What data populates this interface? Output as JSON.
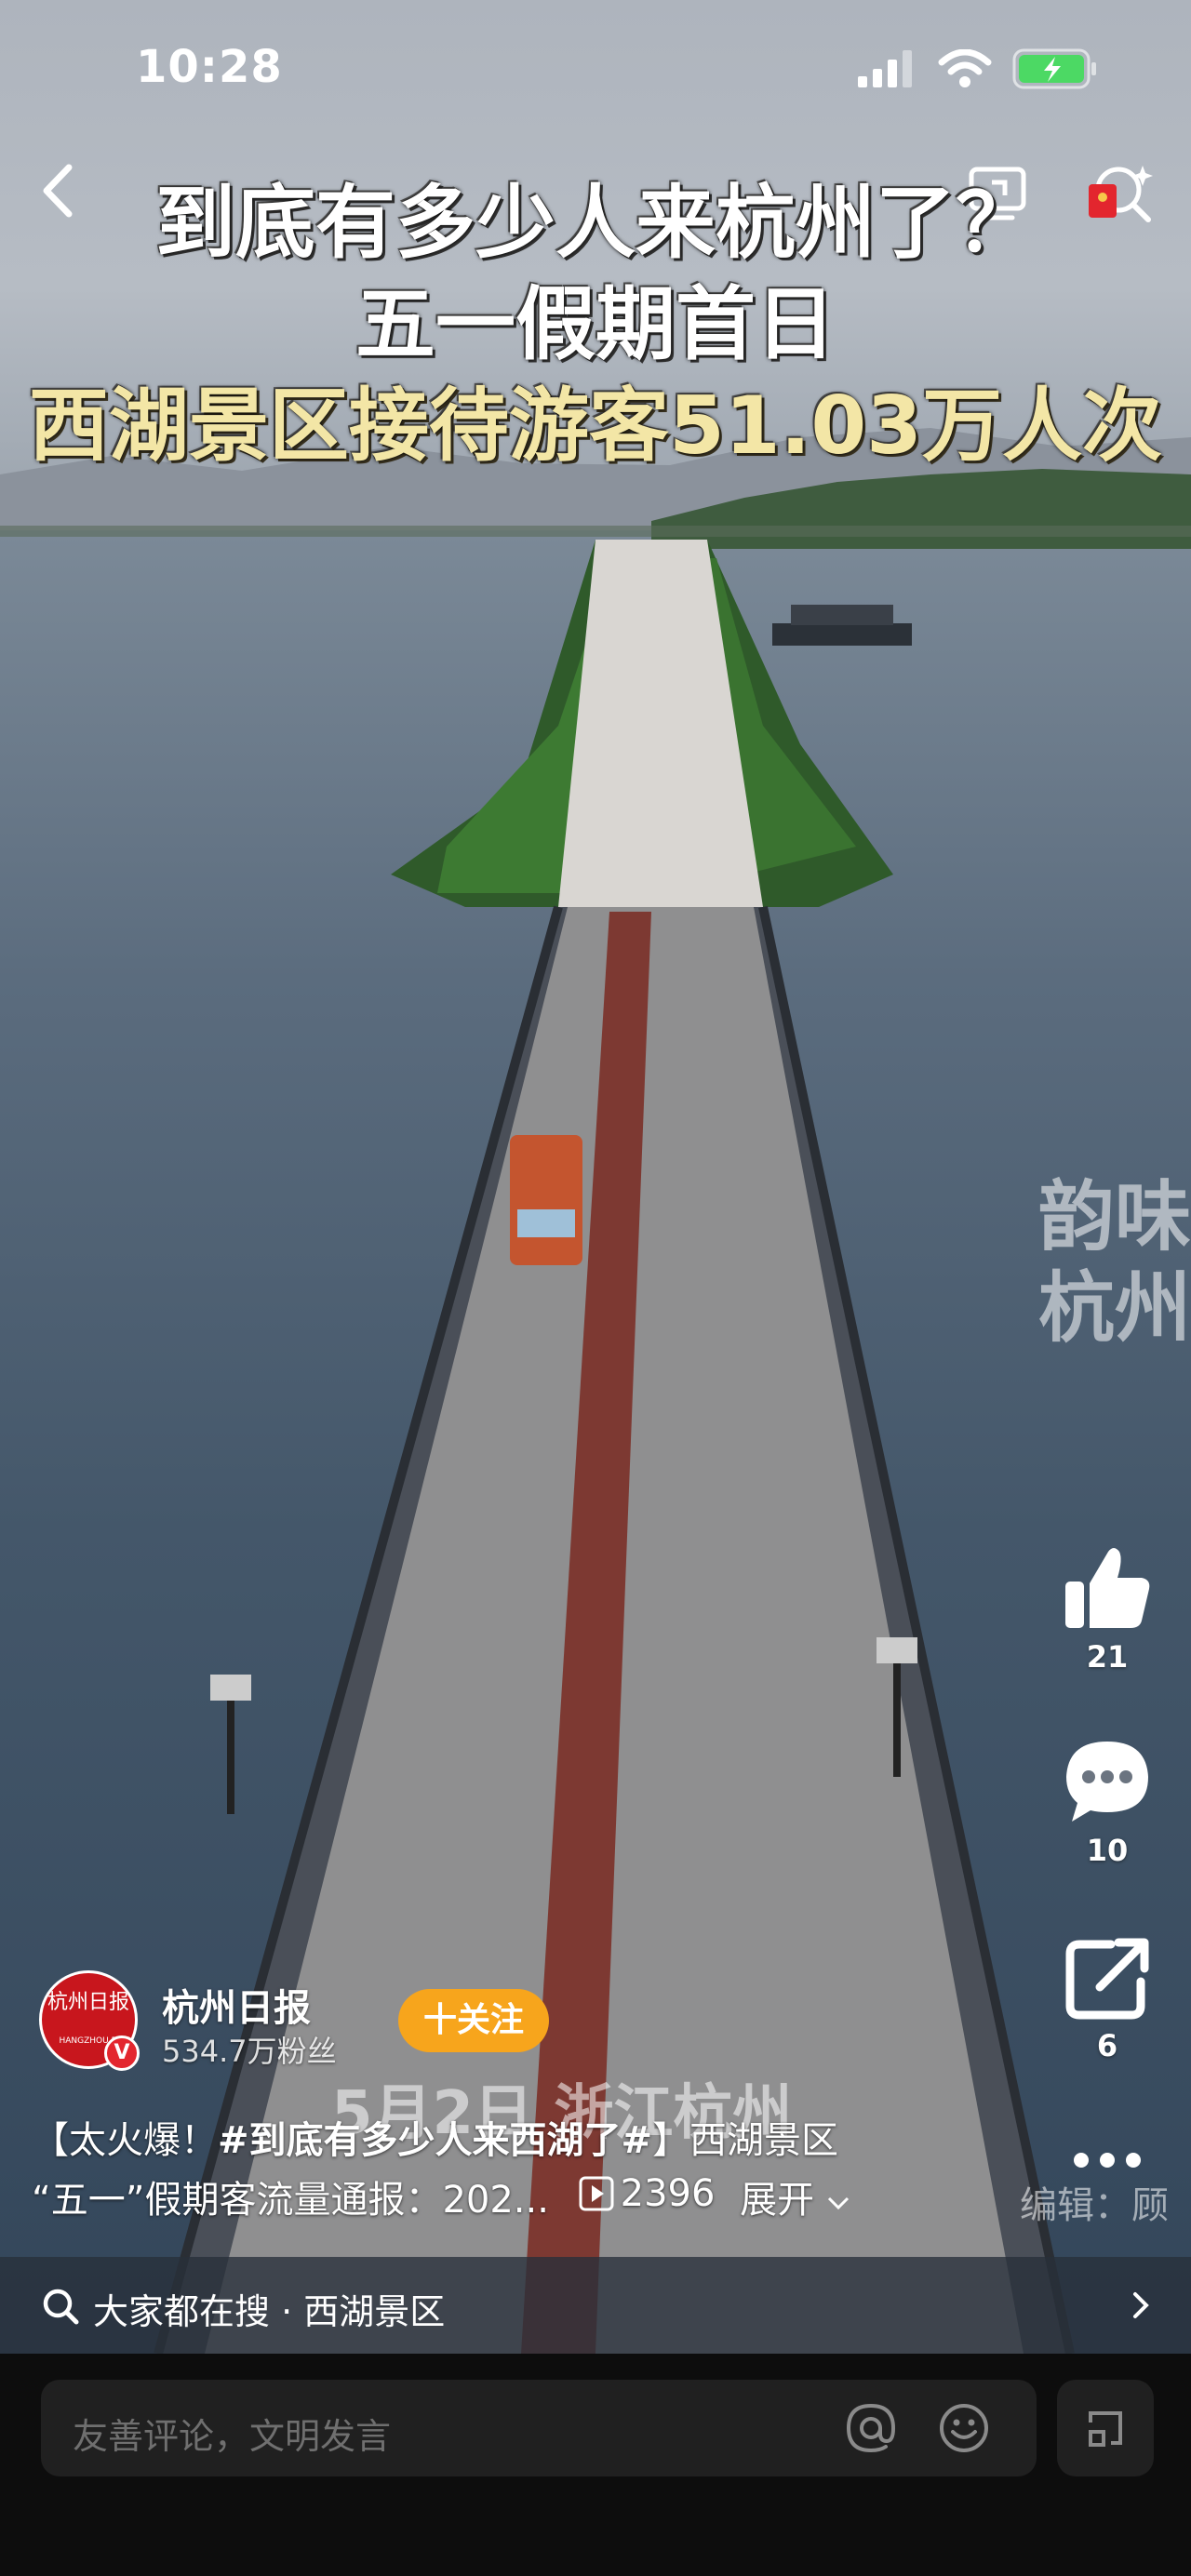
{
  "status_bar": {
    "time": "10:28",
    "battery_color": "#4cd964"
  },
  "headline": {
    "line1": "到底有多少人来杭州了？",
    "line2": "五一假期首日",
    "line3": "西湖景区接待游客51.03万人次"
  },
  "watermark": {
    "line1": "韵味",
    "line2": "杭州"
  },
  "video_caption": "5月2日 浙江杭州",
  "editor_credit": "编辑：顾",
  "actions": {
    "like_count": "21",
    "comment_count": "10",
    "share_count": "6"
  },
  "author": {
    "avatar_text": "杭州日报",
    "avatar_sub": "HANGZHOU D",
    "name": "杭州日报",
    "followers": "534.7万粉丝",
    "follow_label": "十关注"
  },
  "description": {
    "line1_prefix": "【太火爆！",
    "line1_tag": "#到底有多少人来西湖了#",
    "line1_suffix": "】西湖景区",
    "line2_text": "“五一”假期客流量通报：202...",
    "play_count": "2396",
    "expand_label": "展开"
  },
  "search": {
    "prefix": "大家都在搜",
    "dot": "·",
    "query": "西湖景区"
  },
  "comment": {
    "placeholder": "友善评论，文明发言"
  },
  "colors": {
    "accent": "#f7a51c",
    "brand_red": "#c8161d",
    "headline_yellow": "#f3e6a6"
  }
}
